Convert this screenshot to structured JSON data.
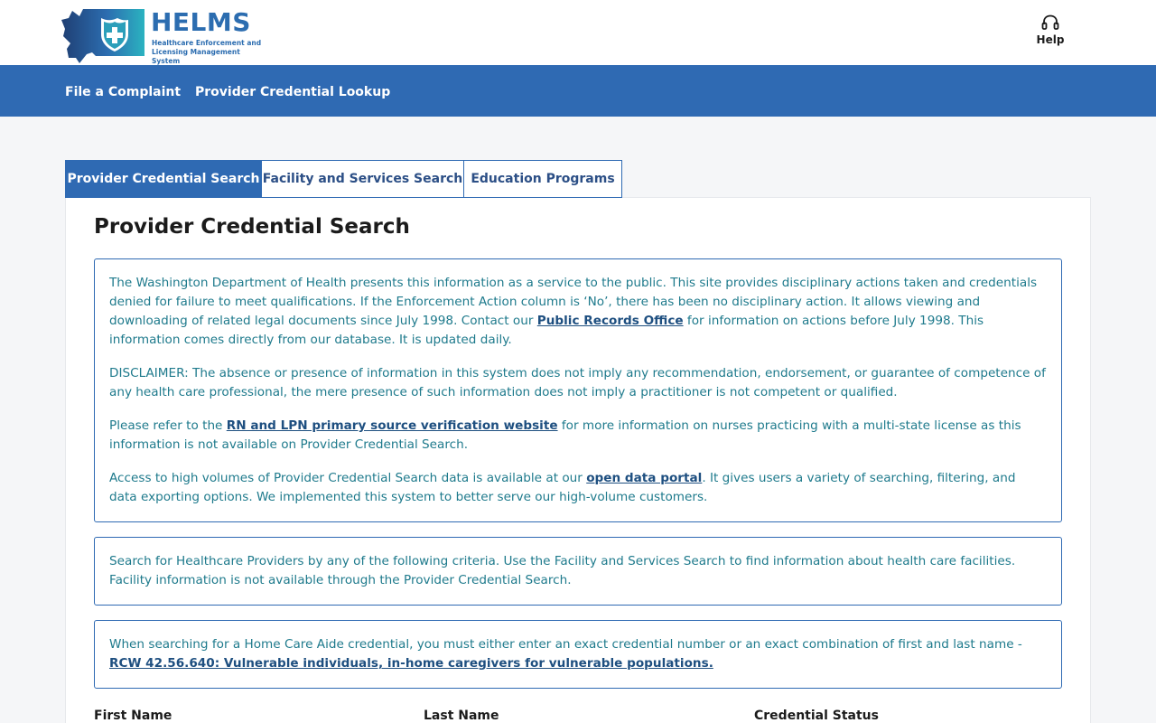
{
  "brand": {
    "wordmark": "HELMS",
    "subtitle_line1": "Healthcare Enforcement and",
    "subtitle_line2": "Licensing Management System",
    "colors": {
      "primary": "#2f6ab3",
      "text_teal": "#1e7a8c",
      "link": "#1e4f80"
    }
  },
  "header": {
    "help_label": "Help",
    "help_icon": "headset-icon"
  },
  "nav": {
    "items": [
      {
        "label": "File a Complaint"
      },
      {
        "label": "Provider Credential Lookup"
      }
    ]
  },
  "tabs": [
    {
      "label": "Provider Credential Search",
      "active": true
    },
    {
      "label": "Facility and Services Search",
      "active": false
    },
    {
      "label": "Education Programs",
      "active": false
    }
  ],
  "main": {
    "title": "Provider Credential Search",
    "notice": {
      "p1_a": "The Washington Department of Health presents this information as a service to the public. This site provides disciplinary actions taken and credentials denied for failure to meet qualifications. If the Enforcement Action column is ‘No’, there has been no disciplinary action. It allows viewing and downloading of related legal documents since July 1998. Contact our ",
      "p1_link": "Public Records Office",
      "p1_b": " for information on actions before July 1998. This information comes directly from our database. It is updated daily.",
      "p2": "DISCLAIMER: The absence or presence of information in this system does not imply any recommendation, endorsement, or guarantee of competence of any health care professional, the mere presence of such information does not imply a practitioner is not competent or qualified.",
      "p3_a": "Please refer to the ",
      "p3_link": "RN and LPN primary source verification website",
      "p3_b": " for more information on nurses practicing with a multi-state license as this information is not available on Provider Credential Search.",
      "p4_a": "Access to high volumes of Provider Credential Search data is available at our ",
      "p4_link": "open data portal",
      "p4_b": ". It gives users a variety of searching, filtering, and data exporting options. We implemented this system to better serve our high-volume customers."
    },
    "criteria_text": "Search for Healthcare Providers by any of the following criteria. Use the Facility and Services Search to find information about health care facilities. Facility information is not available through the Provider Credential Search.",
    "hca": {
      "text": "When searching for a Home Care Aide credential, you must either enter an exact credential number or an exact combination of first and last name - ",
      "link": "RCW 42.56.640: Vulnerable individuals, in-home caregivers for vulnerable populations."
    },
    "form": {
      "first_name_label": "First Name",
      "last_name_label": "Last Name",
      "credential_status_label": "Credential Status"
    }
  }
}
